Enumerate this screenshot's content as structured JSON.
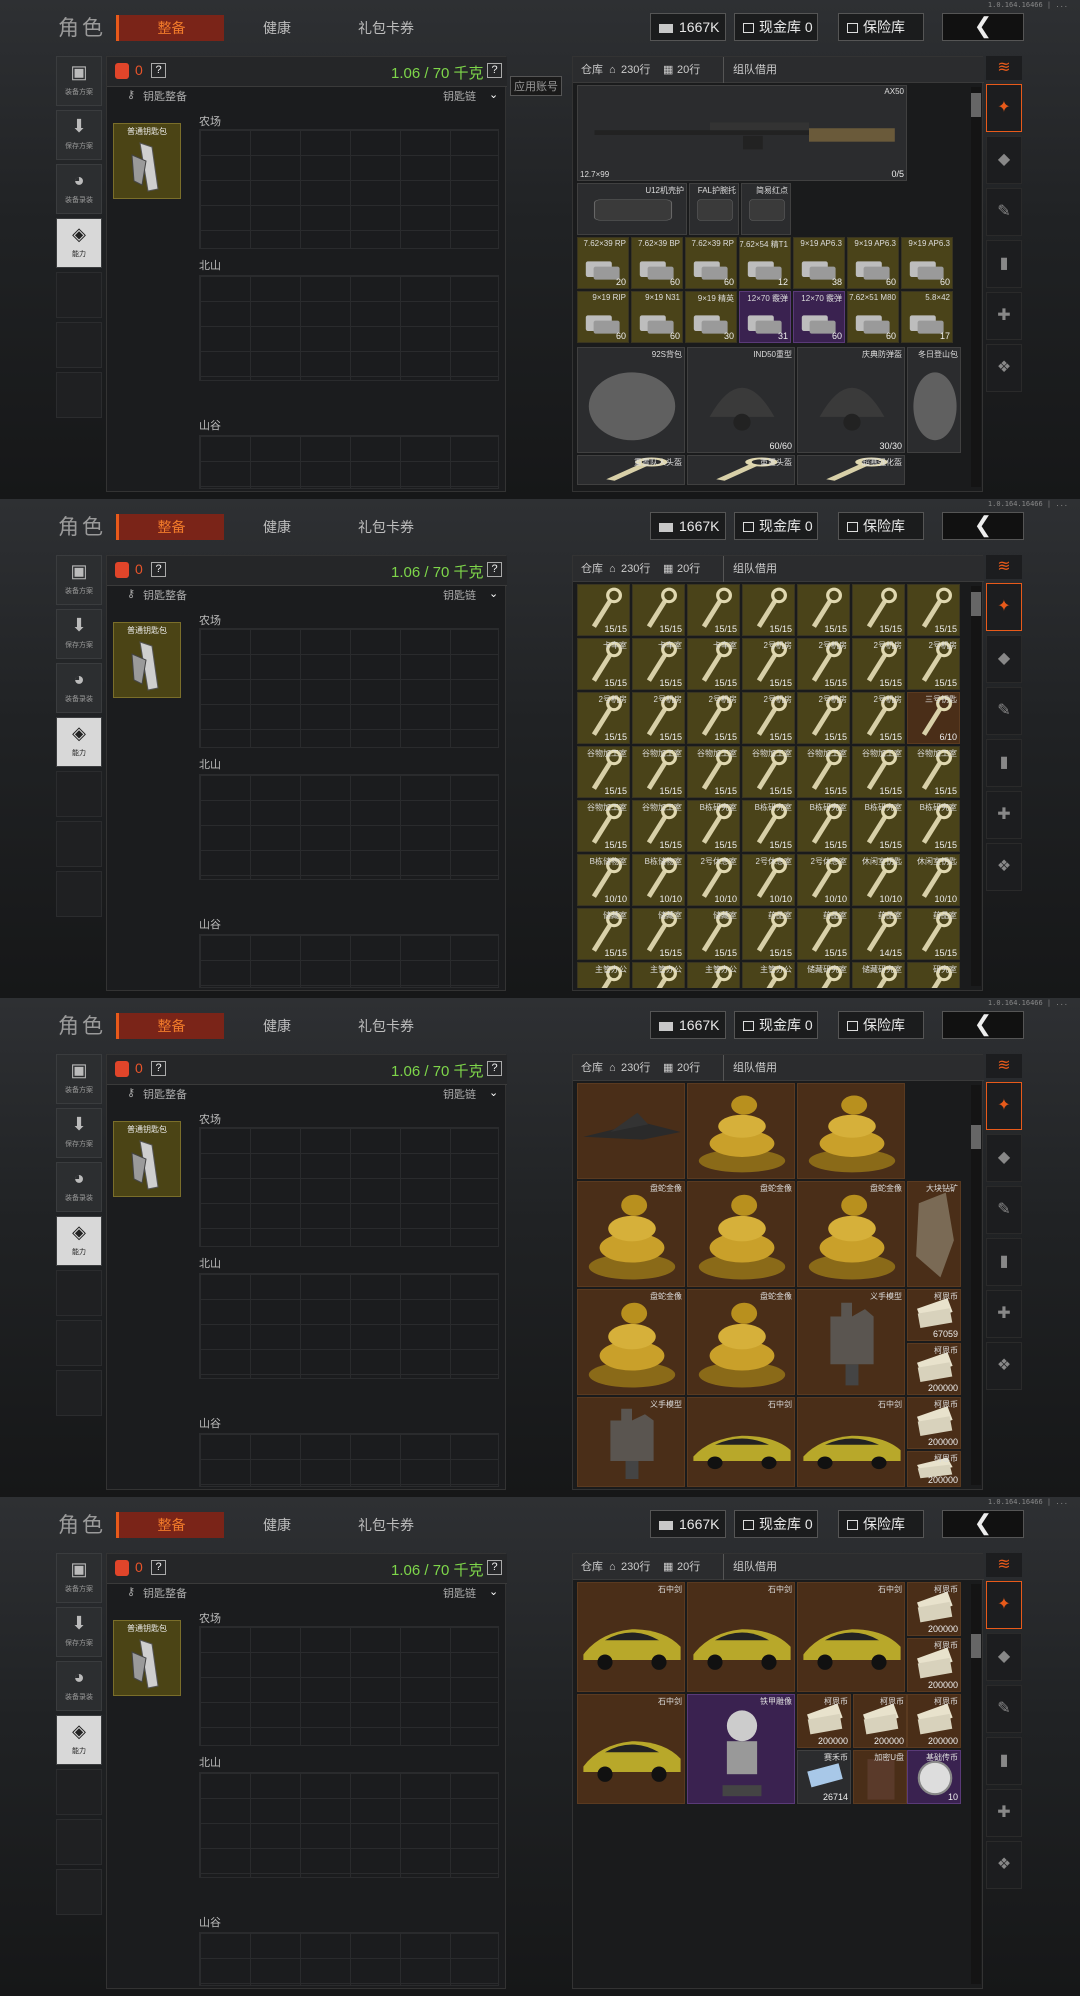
{
  "app": {
    "version": "1.0.164.16466 | ...",
    "title": "角色",
    "tabs": [
      "整备",
      "健康",
      "礼包卡券"
    ],
    "active_tab": "整备"
  },
  "currency": {
    "cash": "1667K",
    "cash_vault": "现金库 0",
    "safe_vault": "保险库"
  },
  "left_buttons": [
    "装备方案",
    "保存方案",
    "装备录装",
    "能力"
  ],
  "loadout": {
    "backpack_count": "0",
    "weight": "1.06 / 70 千克",
    "keychain_label": "钥匙整备",
    "keychain_link": "钥匙链",
    "key_item_name": "普通钥匙包",
    "zones": [
      "农场",
      "北山",
      "山谷"
    ]
  },
  "stash": {
    "label": "仓库",
    "rows": "230行",
    "cols": "20行",
    "team_borrow": "组队借用",
    "side_tooltip": "应用账号"
  },
  "panels": [
    {
      "items": [
        {
          "name": "AX50",
          "caliber": "12.7×99",
          "count": "0/5",
          "type": "rifle",
          "style": "dark"
        },
        {
          "name": "U12机壳护",
          "type": "part",
          "style": "dark"
        },
        {
          "name": "FAL护腕托",
          "type": "part",
          "style": "dark"
        },
        {
          "name": "简易红点",
          "type": "part",
          "style": "dark"
        },
        {
          "name": "7.62×39 RP",
          "count": "20",
          "type": "ammo",
          "style": "gold"
        },
        {
          "name": "7.62×39 BP",
          "count": "60",
          "type": "ammo",
          "style": "gold"
        },
        {
          "name": "7.62×39 RP",
          "count": "60",
          "type": "ammo",
          "style": "gold"
        },
        {
          "name": "7.62×54 精T1",
          "count": "12",
          "type": "ammo",
          "style": "gold"
        },
        {
          "name": "9×19 AP6.3",
          "count": "38",
          "type": "ammo",
          "style": "gold"
        },
        {
          "name": "9×19 AP6.3",
          "count": "60",
          "type": "ammo",
          "style": "gold"
        },
        {
          "name": "9×19 AP6.3",
          "count": "60",
          "type": "ammo",
          "style": "gold"
        },
        {
          "name": "9×19 RIP",
          "count": "60",
          "type": "ammo",
          "style": "gold"
        },
        {
          "name": "9×19 N31",
          "count": "60",
          "type": "ammo",
          "style": "gold"
        },
        {
          "name": "9×19 精英",
          "count": "30",
          "type": "ammo",
          "style": "gold"
        },
        {
          "name": "12×70 霰弹",
          "count": "31",
          "type": "ammo",
          "style": "purple"
        },
        {
          "name": "12×70 霰弹",
          "count": "60",
          "type": "ammo",
          "style": "purple"
        },
        {
          "name": "7.62×51 M80",
          "count": "60",
          "type": "ammo",
          "style": "gold"
        },
        {
          "name": "5.8×42",
          "count": "17",
          "type": "ammo",
          "style": "gold"
        },
        {
          "name": "92S背包",
          "type": "bag",
          "style": "dark"
        },
        {
          "name": "IND50重型",
          "count": "60/60",
          "type": "helmet",
          "style": "dark"
        },
        {
          "name": "庆典防弹盔",
          "count": "30/30",
          "type": "helmet",
          "style": "dark"
        },
        {
          "name": "冬日登山包",
          "type": "bag",
          "style": "dark"
        },
        {
          "name": "重置队人头盔",
          "type": "",
          "style": "dark"
        },
        {
          "name": "重置头盔",
          "type": "",
          "style": "dark"
        },
        {
          "name": "超赛强化盔",
          "type": "",
          "style": "dark"
        }
      ]
    },
    {
      "keys": [
        {
          "name": "",
          "count": "15/15"
        },
        {
          "name": "",
          "count": "15/15"
        },
        {
          "name": "",
          "count": "15/15"
        },
        {
          "name": "",
          "count": "15/15"
        },
        {
          "name": "",
          "count": "15/15"
        },
        {
          "name": "",
          "count": "15/15"
        },
        {
          "name": "",
          "count": "15/15"
        },
        {
          "name": "卡车室",
          "count": "15/15"
        },
        {
          "name": "卡车室",
          "count": "15/15"
        },
        {
          "name": "卡车室",
          "count": "15/15"
        },
        {
          "name": "2号机房",
          "count": "15/15"
        },
        {
          "name": "2号机房",
          "count": "15/15"
        },
        {
          "name": "2号机房",
          "count": "15/15"
        },
        {
          "name": "2号机房",
          "count": "15/15"
        },
        {
          "name": "2号机房",
          "count": "15/15"
        },
        {
          "name": "2号机房",
          "count": "15/15"
        },
        {
          "name": "2号机房",
          "count": "15/15"
        },
        {
          "name": "2号机房",
          "count": "15/15"
        },
        {
          "name": "2号机房",
          "count": "15/15"
        },
        {
          "name": "2号机房",
          "count": "15/15"
        },
        {
          "name": "三号钥匙",
          "count": "6/10",
          "brown": true
        },
        {
          "name": "谷物加工室",
          "count": "15/15"
        },
        {
          "name": "谷物加工室",
          "count": "15/15"
        },
        {
          "name": "谷物加工室",
          "count": "15/15"
        },
        {
          "name": "谷物加工室",
          "count": "15/15"
        },
        {
          "name": "谷物加工室",
          "count": "15/15"
        },
        {
          "name": "谷物加工室",
          "count": "15/15"
        },
        {
          "name": "谷物加工室",
          "count": "15/15"
        },
        {
          "name": "谷物加工室",
          "count": "15/15"
        },
        {
          "name": "谷物加工室",
          "count": "15/15"
        },
        {
          "name": "B栋研究室",
          "count": "15/15"
        },
        {
          "name": "B栋研究室",
          "count": "15/15"
        },
        {
          "name": "B栋研究室",
          "count": "15/15"
        },
        {
          "name": "B栋研究室",
          "count": "15/15"
        },
        {
          "name": "B栋研究室",
          "count": "15/15"
        },
        {
          "name": "B栋储物室",
          "count": "10/10"
        },
        {
          "name": "B栋储物室",
          "count": "10/10"
        },
        {
          "name": "2号休息室",
          "count": "10/10"
        },
        {
          "name": "2号休息室",
          "count": "10/10"
        },
        {
          "name": "2号休息室",
          "count": "10/10"
        },
        {
          "name": "休闲室钥匙",
          "count": "10/10"
        },
        {
          "name": "休闲室钥匙",
          "count": "10/10"
        },
        {
          "name": "储藏室",
          "count": "15/15"
        },
        {
          "name": "储藏室",
          "count": "15/15"
        },
        {
          "name": "储藏室",
          "count": "15/15"
        },
        {
          "name": "药品室",
          "count": "15/15"
        },
        {
          "name": "药品室",
          "count": "15/15"
        },
        {
          "name": "药品室",
          "count": "14/15"
        },
        {
          "name": "药品室",
          "count": "15/15"
        },
        {
          "name": "主管办公",
          "count": "10/10"
        },
        {
          "name": "主管办公",
          "count": "10/10"
        },
        {
          "name": "主管办公",
          "count": "10/10"
        },
        {
          "name": "主管办公",
          "count": "10/10"
        },
        {
          "name": "储藏研究室",
          "count": "10/10"
        },
        {
          "name": "储藏研究室",
          "count": "13/15"
        },
        {
          "name": "研究室",
          "count": "10/10"
        }
      ]
    },
    {
      "items": [
        {
          "name": "",
          "type": "plane"
        },
        {
          "name": "",
          "type": "snake"
        },
        {
          "name": "",
          "type": "snake"
        },
        {
          "name": "盘蛇金像",
          "type": "snake"
        },
        {
          "name": "盘蛇金像",
          "type": "snake"
        },
        {
          "name": "盘蛇金像",
          "type": "snake"
        },
        {
          "name": "大块钻矿",
          "type": "ore"
        },
        {
          "name": "盘蛇金像",
          "type": "snake"
        },
        {
          "name": "盘蛇金像",
          "type": "snake"
        },
        {
          "name": "义手模型",
          "type": "hand"
        },
        {
          "name": "柯恩币",
          "count": "67059",
          "type": "cash"
        },
        {
          "name": "柯恩币",
          "count": "200000",
          "type": "cash"
        },
        {
          "name": "柯恩币",
          "count": "200000",
          "type": "cash"
        },
        {
          "name": "义手模型",
          "type": "hand"
        },
        {
          "name": "石中剑",
          "type": "car"
        },
        {
          "name": "石中剑",
          "type": "car"
        },
        {
          "name": "柯恩币",
          "count": "200000",
          "type": "cash"
        }
      ]
    },
    {
      "items": [
        {
          "name": "石中剑",
          "type": "car"
        },
        {
          "name": "石中剑",
          "type": "car"
        },
        {
          "name": "石中剑",
          "type": "car"
        },
        {
          "name": "柯恩币",
          "count": "200000",
          "type": "cash"
        },
        {
          "name": "柯恩币",
          "count": "200000",
          "type": "cash"
        },
        {
          "name": "石中剑",
          "type": "car"
        },
        {
          "name": "铁甲雕像",
          "type": "statue"
        },
        {
          "name": "柯恩币",
          "count": "200000",
          "type": "cash"
        },
        {
          "name": "柯恩币",
          "count": "200000",
          "type": "cash"
        },
        {
          "name": "柯恩币",
          "count": "200000",
          "type": "cash"
        },
        {
          "name": "赛禾币",
          "count": "26714",
          "type": "cash2"
        },
        {
          "name": "加密U盘",
          "type": "book"
        },
        {
          "name": "基础传币",
          "count": "10",
          "type": "coin"
        }
      ]
    }
  ],
  "colors": {
    "accent": "#e85a1a",
    "weight_green": "#7ed64a",
    "gold_cell": "#4a4319",
    "brown_cell": "#4a2e18",
    "purple_cell": "#3a2250"
  }
}
